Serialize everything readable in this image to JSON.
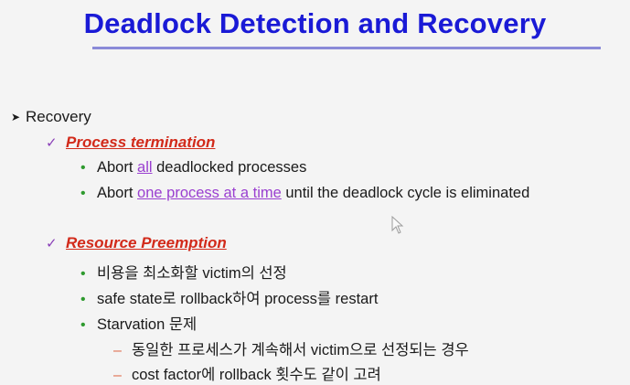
{
  "slide": {
    "title": "Deadlock Detection and Recovery",
    "recovery_label": "Recovery",
    "sections": [
      {
        "heading": "Process termination",
        "items": [
          {
            "pre": "Abort ",
            "hl": "all",
            "post": " deadlocked processes"
          },
          {
            "pre": "Abort ",
            "hl": "one process at a time",
            "post": " until the deadlock cycle is eliminated"
          }
        ]
      },
      {
        "heading": "Resource Preemption",
        "items": [
          {
            "text": "비용을 최소화할 victim의 선정"
          },
          {
            "text": "safe state로 rollback하여 process를 restart"
          },
          {
            "text": "Starvation 문제"
          }
        ],
        "subitems": [
          {
            "text": "동일한 프로세스가 계속해서 victim으로 선정되는 경우"
          },
          {
            "text": "cost factor에 rollback 횟수도 같이 고려"
          }
        ]
      }
    ]
  },
  "colors": {
    "title": "#1a1ad6",
    "rule": "#8a8ad8",
    "section_heading": "#d22a1a",
    "highlight": "#9a3fd0",
    "bullet": "#2e9a2e",
    "check": "#8a3fb8",
    "dash": "#e06a4a"
  },
  "icons": {
    "recovery_bullet": "arrow-bullet-icon",
    "section_marker": "checkmark-icon",
    "item_marker": "dot-bullet-icon",
    "subitem_marker": "dash-bullet-icon",
    "pointer": "mouse-cursor-icon"
  }
}
